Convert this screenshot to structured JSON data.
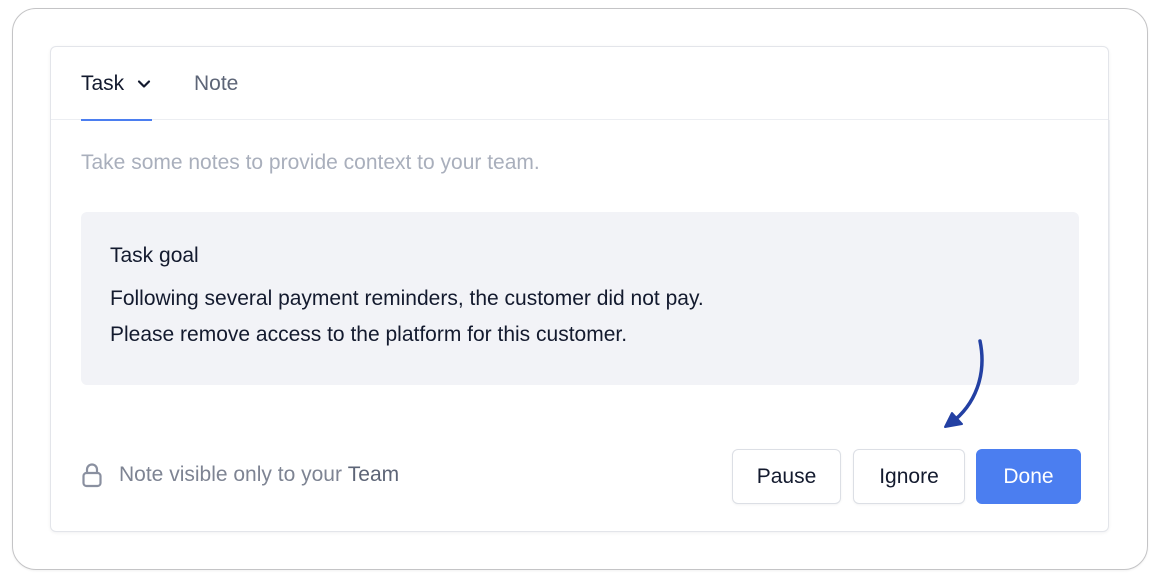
{
  "tabs": {
    "task_label": "Task",
    "note_label": "Note",
    "active": "Task"
  },
  "editor": {
    "placeholder": "Take some notes to provide context to your team."
  },
  "task_goal": {
    "title": "Task goal",
    "line1": "Following several payment reminders, the customer did not pay.",
    "line2": "Please remove access to the platform for this customer."
  },
  "footer": {
    "visibility_prefix": "Note visible only to your ",
    "visibility_team": "Team",
    "lock_icon": "lock-icon"
  },
  "actions": {
    "pause_label": "Pause",
    "ignore_label": "Ignore",
    "done_label": "Done"
  },
  "colors": {
    "accent": "#4b7ef0",
    "annotation_arrow": "#2340a3",
    "text_primary": "#131a2e",
    "text_muted": "#a9afbc",
    "goal_background": "#f2f3f7"
  }
}
